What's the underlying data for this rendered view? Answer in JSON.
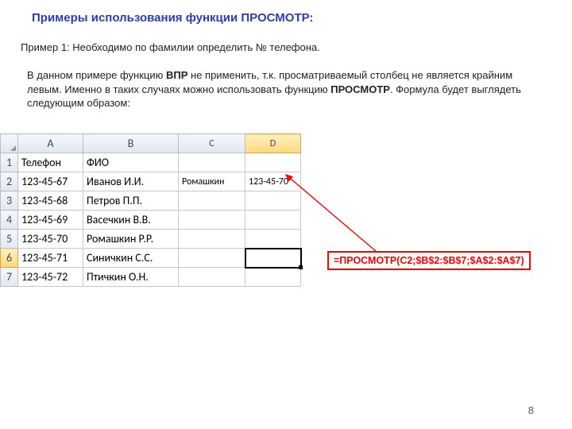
{
  "title": "Примеры использования функции ПРОСМОТР:",
  "subtitle": "Пример 1: Необходимо по фамилии определить № телефона.",
  "para_pre": "В данном примере функцию ",
  "para_b1": "ВПР",
  "para_mid": " не применить, т.к. просматриваемый столбец не является крайним левым. Именно в таких случаях можно использовать функцию ",
  "para_b2": "ПРОСМОТР",
  "para_post": ". Формула будет выглядеть следующим образом:",
  "cols": {
    "A": "A",
    "B": "B",
    "C": "C",
    "D": "D"
  },
  "rows": [
    "1",
    "2",
    "3",
    "4",
    "5",
    "6",
    "7"
  ],
  "table": {
    "r1": {
      "A": "Телефон",
      "B": "ФИО",
      "C": "",
      "D": ""
    },
    "r2": {
      "A": "123-45-67",
      "B": "Иванов И.И.",
      "C": "Ромашкин",
      "D": "123-45-70"
    },
    "r3": {
      "A": "123-45-68",
      "B": "Петров П.П.",
      "C": "",
      "D": ""
    },
    "r4": {
      "A": "123-45-69",
      "B": "Васечкин В.В.",
      "C": "",
      "D": ""
    },
    "r5": {
      "A": "123-45-70",
      "B": "Ромашкин Р.Р.",
      "C": "",
      "D": ""
    },
    "r6": {
      "A": "123-45-71",
      "B": "Синичкин С.С.",
      "C": "",
      "D": ""
    },
    "r7": {
      "A": "123-45-72",
      "B": "Птичкин О.Н.",
      "C": "",
      "D": ""
    }
  },
  "formula": "=ПРОСМОТР(C2;$B$2:$B$7;$A$2:$A$7)",
  "page": "8"
}
